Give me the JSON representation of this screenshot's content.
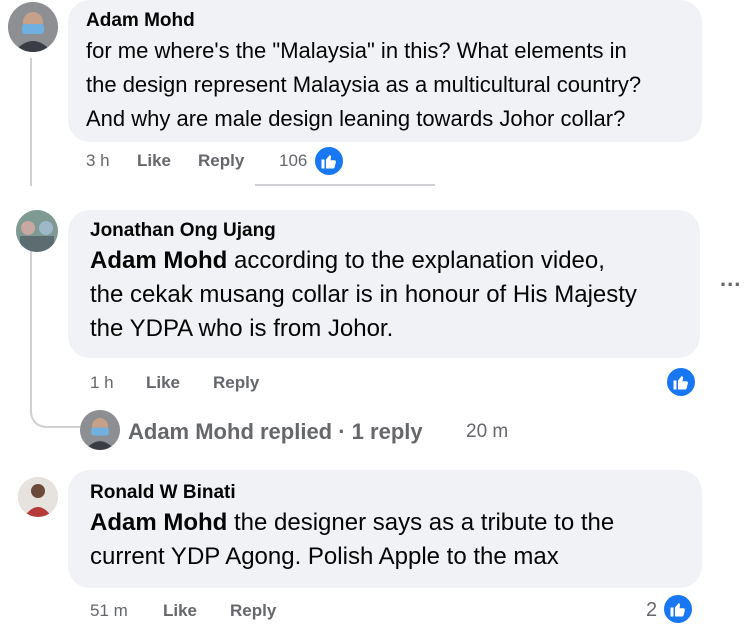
{
  "comments": [
    {
      "author": "Adam Mohd",
      "text": "for me where's the \"Malaysia\" in this? What elements in\nthe design represent Malaysia as a multicultural country?\nAnd why are male design leaning towards Johor collar?",
      "time": "3 h",
      "like_label": "Like",
      "reply_label": "Reply",
      "reaction_count": "106"
    },
    {
      "author": "Jonathan Ong Ujang",
      "mention": "Adam Mohd",
      "text": " according to the explanation video,\nthe cekak musang collar is in honour of His Majesty\nthe YDPA who is from Johor.",
      "time": "1 h",
      "like_label": "Like",
      "reply_label": "Reply",
      "more_options": "..."
    },
    {
      "author": "Ronald W Binati",
      "mention": "Adam Mohd",
      "text": " the designer says as a tribute to the\ncurrent YDP Agong. Polish Apple to the max",
      "time": "51 m",
      "like_label": "Like",
      "reply_label": "Reply",
      "reaction_count": "2"
    }
  ],
  "reply_summary": {
    "text": "Adam Mohd replied · 1 reply",
    "time": "20 m"
  },
  "colors": {
    "bubble": "#f0f2f5",
    "meta": "#65676b",
    "like_blue": "#1877f2",
    "thread_line": "#ced0d4"
  }
}
